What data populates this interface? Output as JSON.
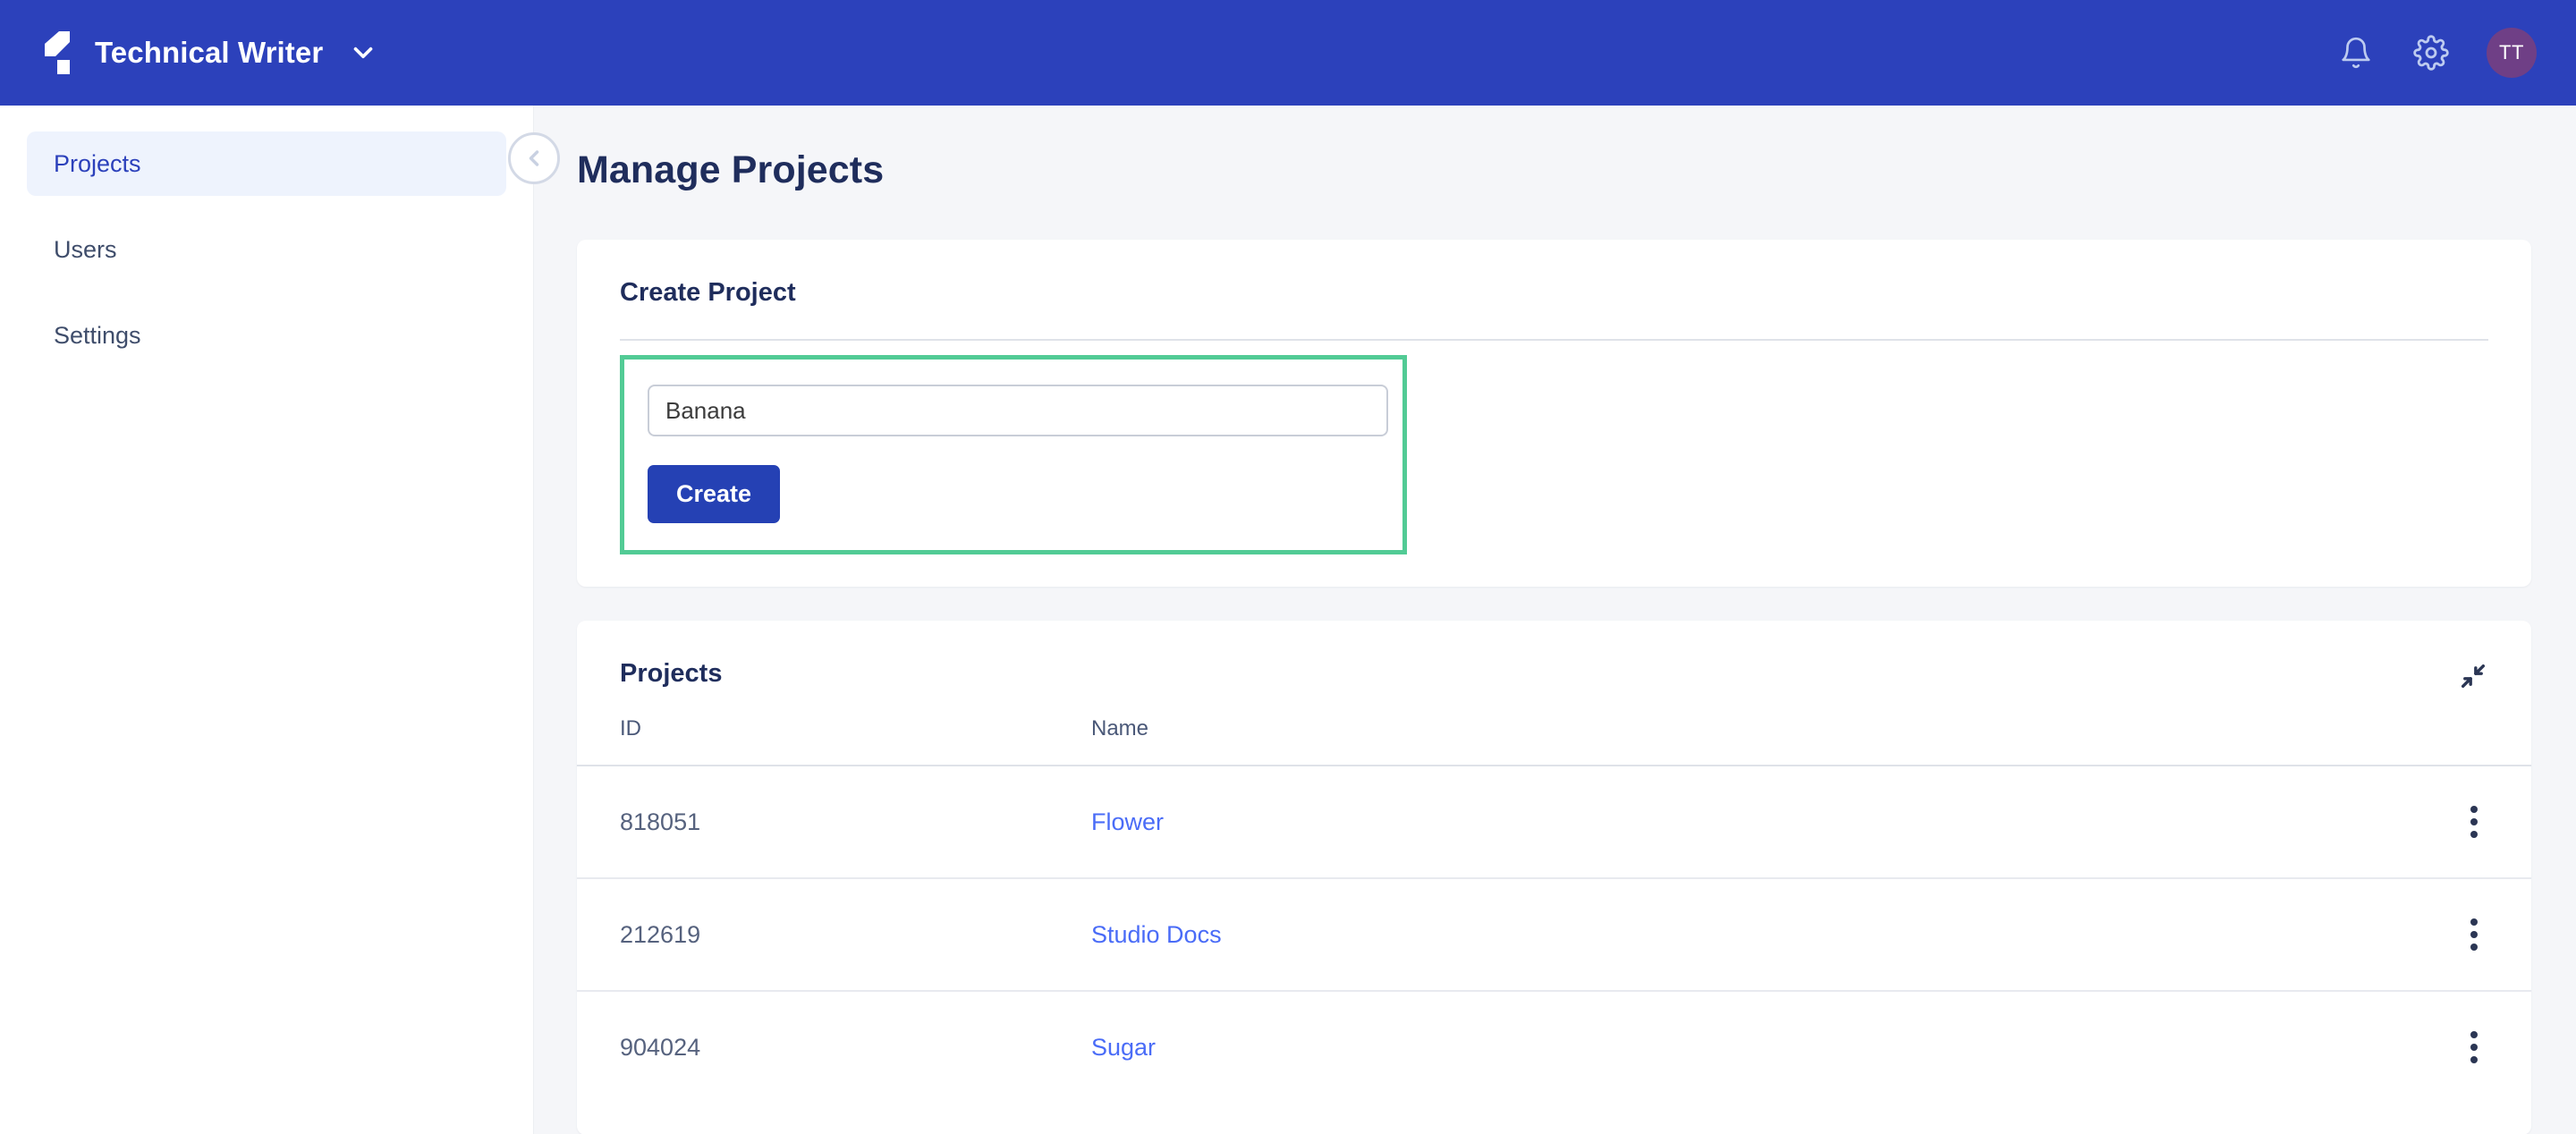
{
  "topbar": {
    "brand_name": "Technical Writer",
    "logo_icon": "app-logo-icon",
    "caret_icon": "chevron-down-icon",
    "notifications_icon": "bell-icon",
    "settings_icon": "gear-icon",
    "avatar_initials": "TT",
    "avatar_color": "#6f3f86",
    "background_color": "#2c41bb"
  },
  "sidebar": {
    "items": [
      {
        "label": "Projects",
        "active": true
      },
      {
        "label": "Users",
        "active": false
      },
      {
        "label": "Settings",
        "active": false
      }
    ],
    "collapse_icon": "chevron-left-circle-icon"
  },
  "main": {
    "page_title": "Manage Projects",
    "create_card": {
      "title": "Create Project",
      "input_value": "Banana",
      "input_placeholder": "",
      "create_label": "Create",
      "highlight_color": "#52cb95"
    },
    "projects_card": {
      "title": "Projects",
      "collapse_icon": "collapse-arrows-icon",
      "columns": [
        "ID",
        "Name"
      ],
      "rows": [
        {
          "id": "818051",
          "name": "Flower",
          "menu_icon": "more-vertical-icon"
        },
        {
          "id": "212619",
          "name": "Studio Docs",
          "menu_icon": "more-vertical-icon"
        },
        {
          "id": "904024",
          "name": "Sugar",
          "menu_icon": "more-vertical-icon"
        }
      ]
    }
  }
}
